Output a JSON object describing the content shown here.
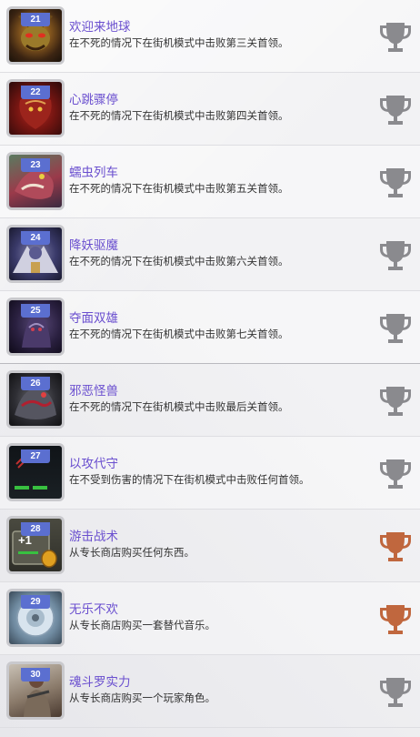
{
  "achievements": [
    {
      "number": "21",
      "title": "欢迎来地球",
      "description": "在不死的情况下在街机模式中击败第三关首领。",
      "trophy": "silver-trophy-icon",
      "trophy_color": "#8a8a8e",
      "thumb": "demon-boss-portrait"
    },
    {
      "number": "22",
      "title": "心跳骤停",
      "description": "在不死的情况下在街机模式中击败第四关首领。",
      "trophy": "silver-trophy-icon",
      "trophy_color": "#8a8a8e",
      "thumb": "red-alien-heart-portrait"
    },
    {
      "number": "23",
      "title": "蠕虫列车",
      "description": "在不死的情况下在街机模式中击败第五关首领。",
      "trophy": "silver-trophy-icon",
      "trophy_color": "#8a8a8e",
      "thumb": "alien-worm-portrait"
    },
    {
      "number": "24",
      "title": "降妖驱魔",
      "description": "在不死的情况下在街机模式中击败第六关首领。",
      "trophy": "silver-trophy-icon",
      "trophy_color": "#8a8a8e",
      "thumb": "robot-demon-portrait"
    },
    {
      "number": "25",
      "title": "夺面双雄",
      "description": "在不死的情况下在街机模式中击败第七关首领。",
      "trophy": "silver-trophy-icon",
      "trophy_color": "#8a8a8e",
      "thumb": "dark-alien-portrait"
    },
    {
      "number": "26",
      "title": "邪恶怪兽",
      "description": "在不死的情况下在街机模式中击败最后关首领。",
      "trophy": "silver-trophy-icon",
      "trophy_color": "#8a8a8e",
      "thumb": "final-boss-portrait"
    },
    {
      "number": "27",
      "title": "以攻代守",
      "description": "在不受到伤害的情况下在街机模式中击败任何首领。",
      "trophy": "silver-trophy-icon",
      "trophy_color": "#8a8a8e",
      "thumb": "health-bar-portrait"
    },
    {
      "number": "28",
      "title": "游击战术",
      "description": "从专长商店购买任何东西。",
      "trophy": "bronze-trophy-icon",
      "trophy_color": "#c0673e",
      "thumb": "plus-one-coin-portrait",
      "thumb_text": "+1"
    },
    {
      "number": "29",
      "title": "无乐不欢",
      "description": "从专长商店购买一套替代音乐。",
      "trophy": "bronze-trophy-icon",
      "trophy_color": "#c0673e",
      "thumb": "cd-disc-portrait"
    },
    {
      "number": "30",
      "title": "魂斗罗实力",
      "description": "从专长商店购买一个玩家角色。",
      "trophy": "silver-trophy-icon",
      "trophy_color": "#8a8a8e",
      "thumb": "soldier-portrait"
    }
  ]
}
